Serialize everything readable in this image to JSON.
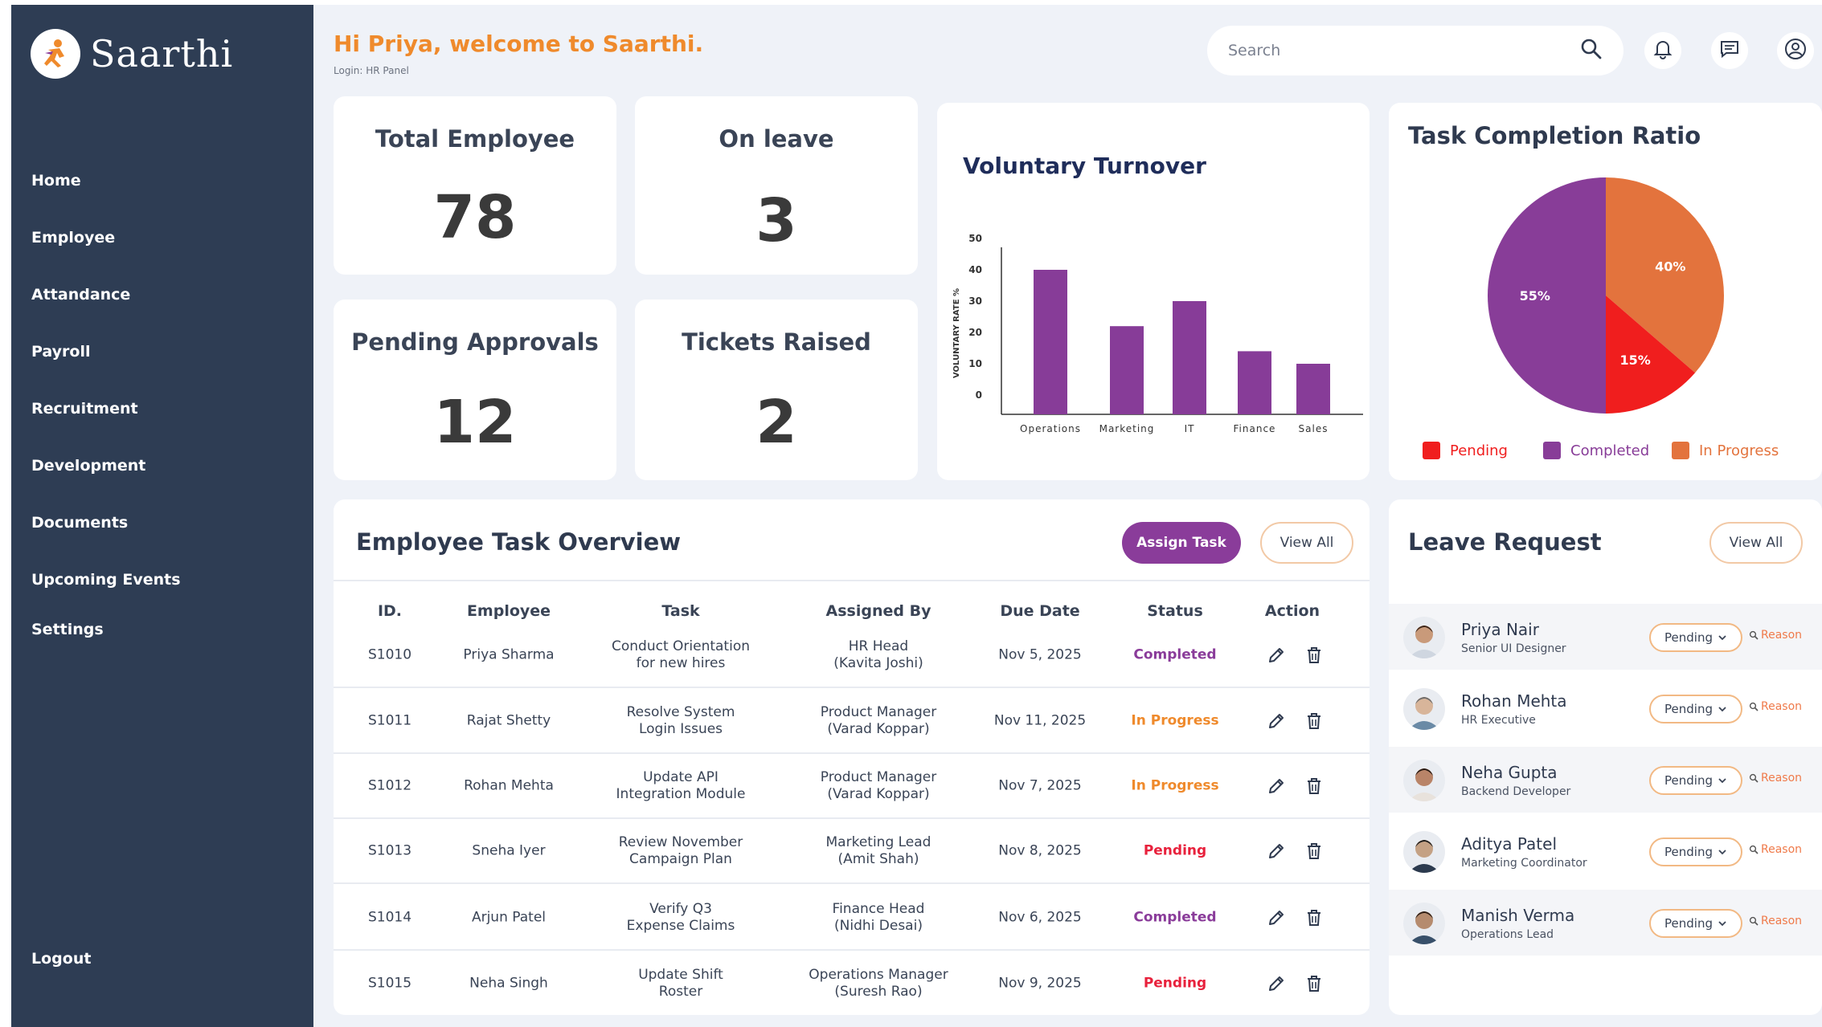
{
  "brand": {
    "name": "Saarthi"
  },
  "sidebar": {
    "items": [
      {
        "label": "Home"
      },
      {
        "label": "Employee"
      },
      {
        "label": "Attandance"
      },
      {
        "label": "Payroll"
      },
      {
        "label": "Recruitment"
      },
      {
        "label": "Development"
      },
      {
        "label": "Documents"
      },
      {
        "label": "Upcoming Events"
      },
      {
        "label": "Settings"
      }
    ],
    "logout": "Logout"
  },
  "header": {
    "greeting": "Hi Priya, welcome to Saarthi.",
    "login": "Login: HR Panel",
    "search_placeholder": "Search"
  },
  "icons": {
    "search": "search-icon",
    "notifications": "bell-icon",
    "messages": "message-icon",
    "profile": "user-circle-icon",
    "edit": "pencil-icon",
    "delete": "trash-icon"
  },
  "stats": [
    {
      "label": "Total Employee",
      "value": "78"
    },
    {
      "label": "On leave",
      "value": "3"
    },
    {
      "label": "Pending Approvals",
      "value": "12"
    },
    {
      "label": "Tickets Raised",
      "value": "2"
    }
  ],
  "chart_data": [
    {
      "type": "bar",
      "title": "Voluntary Turnover",
      "ylabel": "VOLUNTARY RATE %",
      "xlabel": "",
      "categories": [
        "Operations",
        "Marketing",
        "IT",
        "Finance",
        "Sales"
      ],
      "values": [
        40,
        22,
        30,
        14,
        10
      ],
      "yticks": [
        0,
        10,
        20,
        30,
        40,
        50
      ],
      "ylim": [
        0,
        50
      ],
      "color": "#873c98",
      "grid": false
    },
    {
      "type": "pie",
      "title": "Task Completion Ratio",
      "labels": [
        "Pending",
        "Completed",
        "In Progress"
      ],
      "values": [
        15,
        55,
        40
      ],
      "slice_labels": [
        "15%",
        "55%",
        "40%"
      ],
      "colors": [
        "#f01e1e",
        "#883d98",
        "#e3733d"
      ],
      "legend_placement": "bottom"
    }
  ],
  "task_overview": {
    "title": "Employee Task Overview",
    "assign_label": "Assign Task",
    "view_all_label": "View All",
    "columns": [
      "ID.",
      "Employee",
      "Task",
      "Assigned By",
      "Due Date",
      "Status",
      "Action"
    ],
    "rows": [
      {
        "id": "S1010",
        "employee": "Priya Sharma",
        "task": [
          "Conduct Orientation",
          "for new hires"
        ],
        "assigned_by": [
          "HR Head",
          "(Kavita Joshi)"
        ],
        "due": "Nov 5, 2025",
        "status": "Completed"
      },
      {
        "id": "S1011",
        "employee": "Rajat Shetty",
        "task": [
          "Resolve System",
          "Login Issues"
        ],
        "assigned_by": [
          "Product Manager",
          "(Varad Koppar)"
        ],
        "due": "Nov 11, 2025",
        "status": "In Progress"
      },
      {
        "id": "S1012",
        "employee": "Rohan Mehta",
        "task": [
          "Update API",
          "Integration Module"
        ],
        "assigned_by": [
          "Product Manager",
          "(Varad Koppar)"
        ],
        "due": "Nov 7, 2025",
        "status": "In Progress"
      },
      {
        "id": "S1013",
        "employee": "Sneha Iyer",
        "task": [
          "Review November",
          "Campaign Plan"
        ],
        "assigned_by": [
          "Marketing Lead",
          "(Amit Shah)"
        ],
        "due": "Nov 8, 2025",
        "status": "Pending"
      },
      {
        "id": "S1014",
        "employee": "Arjun Patel",
        "task": [
          "Verify Q3",
          "Expense Claims"
        ],
        "assigned_by": [
          "Finance Head",
          "(Nidhi Desai)"
        ],
        "due": "Nov 6, 2025",
        "status": "Completed"
      },
      {
        "id": "S1015",
        "employee": "Neha Singh",
        "task": [
          "Update Shift",
          "Roster"
        ],
        "assigned_by": [
          "Operations Manager",
          "(Suresh Rao)"
        ],
        "due": "Nov 9, 2025",
        "status": "Pending"
      }
    ],
    "status_colors": {
      "Completed": "#8a3c9a",
      "In Progress": "#ef8a2c",
      "Pending": "#e8213c"
    }
  },
  "leave_request": {
    "title": "Leave Request",
    "view_all_label": "View All",
    "items": [
      {
        "name": "Priya Nair",
        "role": "Senior UI Designer",
        "status": "Pending",
        "reason": "Reason"
      },
      {
        "name": "Rohan Mehta",
        "role": "HR Executive",
        "status": "Pending",
        "reason": "Reason"
      },
      {
        "name": "Neha Gupta",
        "role": "Backend Developer",
        "status": "Pending",
        "reason": "Reason"
      },
      {
        "name": "Aditya Patel",
        "role": "Marketing Coordinator",
        "status": "Pending",
        "reason": "Reason"
      },
      {
        "name": "Manish Verma",
        "role": "Operations Lead",
        "status": "Pending",
        "reason": "Reason"
      }
    ]
  }
}
